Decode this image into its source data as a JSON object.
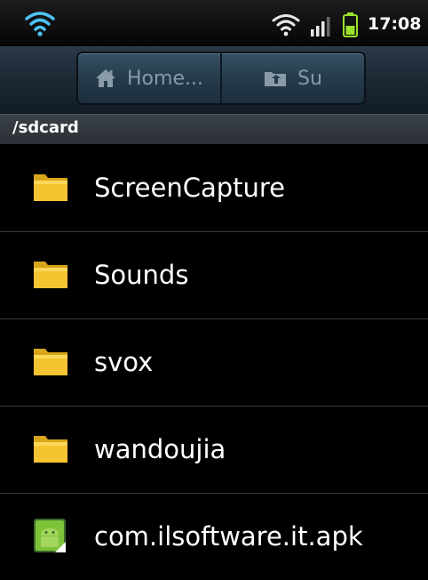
{
  "status_bar": {
    "time": "17:08",
    "icons": [
      "wifi-icon",
      "wifi-icon",
      "signal-icon",
      "battery-icon"
    ],
    "accent_color": "#4fc3f7",
    "battery_color": "#9ae12a"
  },
  "toolbar": {
    "buttons": [
      {
        "label": "Home...",
        "icon": "home-icon"
      },
      {
        "label": "Su",
        "icon": "folder-up-icon"
      }
    ]
  },
  "path": {
    "current": "/sdcard"
  },
  "files": [
    {
      "name": "ScreenCapture",
      "type": "folder",
      "icon": "folder-icon"
    },
    {
      "name": "Sounds",
      "type": "folder",
      "icon": "folder-icon"
    },
    {
      "name": "svox",
      "type": "folder",
      "icon": "folder-icon"
    },
    {
      "name": "wandoujia",
      "type": "folder",
      "icon": "folder-icon"
    },
    {
      "name": "com.ilsoftware.it.apk",
      "type": "apk",
      "icon": "android-apk-icon"
    }
  ],
  "colors": {
    "folder": "#f5c431",
    "toolbar_text": "#8a9ba8"
  }
}
